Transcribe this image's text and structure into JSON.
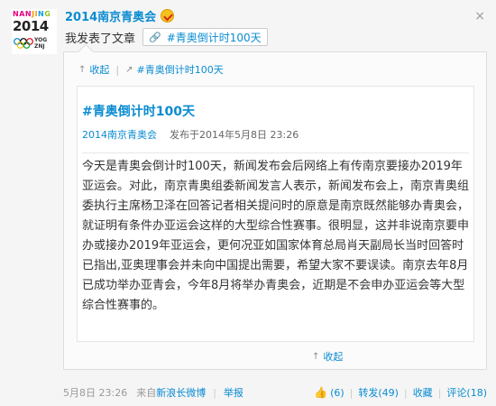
{
  "logo": {
    "top_a": "NAN",
    "top_b": "JI",
    "top_c": "N",
    "top_d": "G",
    "year": "2014",
    "yog": "YOG\nZNJ"
  },
  "user": {
    "name": "2014南京青奥会"
  },
  "status": {
    "text": "我发表了文章",
    "tag": "#青奥倒计时100天"
  },
  "card": {
    "collapse": "收起",
    "topic_link": "#青奥倒计时100天",
    "article": {
      "title": "#青奥倒计时100天",
      "author": "2014南京青奥会",
      "published": "发布于2014年5月8日  23:26",
      "body": "今天是青奥会倒计时100天，新闻发布会后网络上有传南京要接办2019年亚运会。对此，南京青奥组委新闻发言人表示，新闻发布会上，南京青奥组委执行主席杨卫泽在回答记者相关提问时的原意是南京既然能够办青奥会，就证明有条件办亚运会这样的大型综合性赛事。很明显，这并非说南京要申办或接办2019年亚运会，更何况亚如国家体育总局肖天副局长当时回答时已指出,亚奥理事会并未向中国提出需要，希望大家不要误读。南京去年8月已成功举办亚青会，今年8月将举办青奥会，近期是不会申办亚运会等大型综合性赛事的。"
    },
    "collapse_bottom": "收起"
  },
  "footer": {
    "time": "5月8日 23:26",
    "source_prefix": "来自",
    "source": "新浪长微博",
    "report": "举报",
    "like": "(6)",
    "repost": "转发(49)",
    "favorite": "收藏",
    "comment": "评论(18)"
  },
  "colors": {
    "link": "#0a8cd2",
    "background": "#f5f5f5"
  }
}
